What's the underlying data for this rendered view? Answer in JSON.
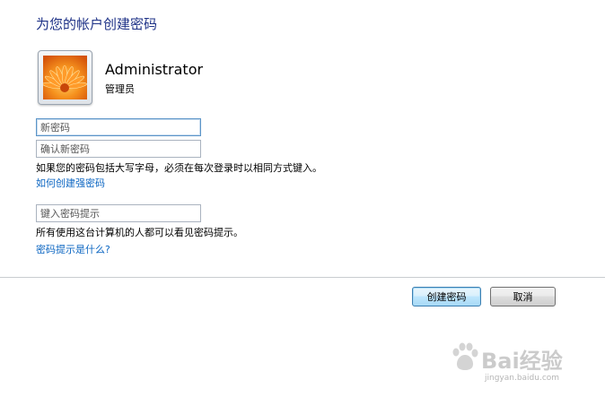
{
  "dialog": {
    "title": "为您的帐户创建密码"
  },
  "user": {
    "name": "Administrator",
    "role": "管理员",
    "avatar_icon": "flower-avatar-icon"
  },
  "fields": {
    "new_password_placeholder": "新密码",
    "confirm_password_placeholder": "确认新密码",
    "hint_placeholder": "键入密码提示"
  },
  "notes": {
    "case_sensitive": "如果您的密码包括大写字母，必须在每次登录时以相同方式键入。",
    "hint_visibility": "所有使用这台计算机的人都可以看见密码提示。"
  },
  "links": {
    "strong_password": "如何创建强密码",
    "what_is_hint": "密码提示是什么?"
  },
  "buttons": {
    "create": "创建密码",
    "cancel": "取消"
  },
  "watermark": {
    "text": "Bai经验",
    "url": "jingyan.baidu.com"
  },
  "colors": {
    "title": "#1e3287",
    "link": "#0c66c2",
    "focus_border": "#5c95c8",
    "default_button_border": "#3c7fb1"
  }
}
